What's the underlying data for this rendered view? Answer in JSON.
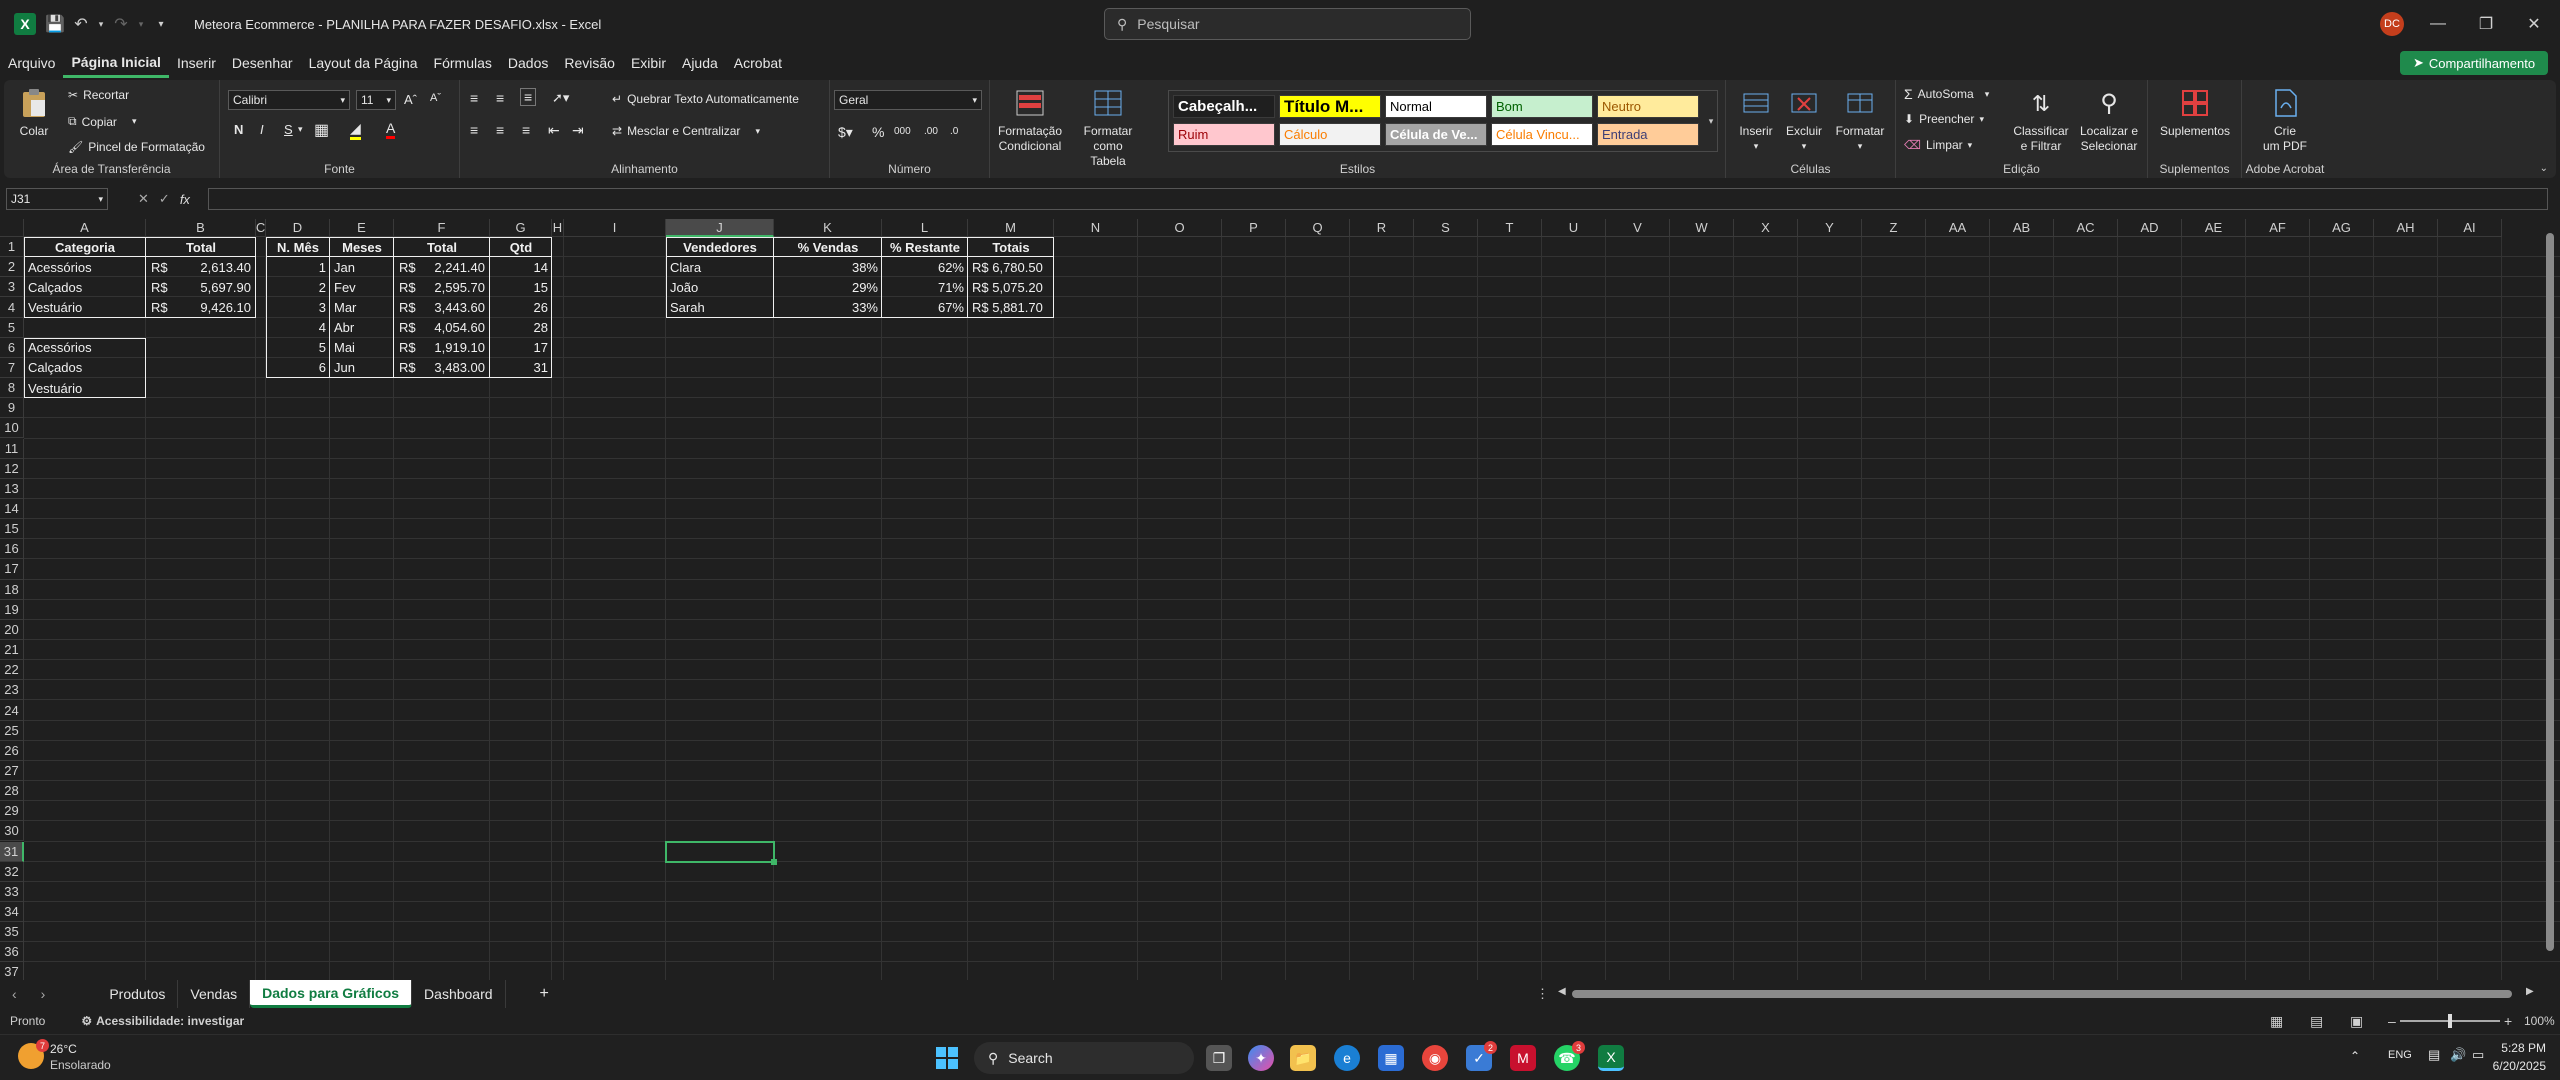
{
  "titlebar": {
    "doc_title": "Meteora Ecommerce - PLANILHA PARA FAZER DESAFIO.xlsx  -  Excel",
    "search_placeholder": "Pesquisar",
    "user_initials": "DC"
  },
  "menu": {
    "items": [
      "Arquivo",
      "Página Inicial",
      "Inserir",
      "Desenhar",
      "Layout da Página",
      "Fórmulas",
      "Dados",
      "Revisão",
      "Exibir",
      "Ajuda",
      "Acrobat"
    ],
    "share_label": "Compartilhamento"
  },
  "ribbon": {
    "clipboard": {
      "paste": "Colar",
      "cut": "Recortar",
      "copy": "Copiar",
      "format_painter": "Pincel de Formatação",
      "label": "Área de Transferência"
    },
    "font": {
      "family": "Calibri",
      "size": "11",
      "label": "Fonte"
    },
    "alignment": {
      "wrap": "Quebrar Texto Automaticamente",
      "merge": "Mesclar e Centralizar",
      "label": "Alinhamento"
    },
    "number": {
      "format": "Geral",
      "label": "Número"
    },
    "styles": {
      "cond_format": [
        "Formatação",
        "Condicional"
      ],
      "format_table": [
        "Formatar como",
        "Tabela"
      ],
      "cells": [
        "Cabeçalh...",
        "Título M...",
        "Normal",
        "Bom",
        "Neutro",
        "Ruim",
        "Cálculo",
        "Célula de Ve...",
        "Célula Vincu...",
        "Entrada"
      ],
      "label": "Estilos"
    },
    "cells": {
      "insert": "Inserir",
      "delete": "Excluir",
      "format": "Formatar",
      "label": "Células"
    },
    "editing": {
      "autosum": "AutoSoma",
      "fill": "Preencher",
      "clear": "Limpar",
      "sort": [
        "Classificar",
        "e Filtrar"
      ],
      "find": [
        "Localizar e",
        "Selecionar"
      ],
      "label": "Edição"
    },
    "addins": {
      "button": "Suplementos",
      "label": "Suplementos"
    },
    "acrobat": {
      "button": [
        "Crie",
        "um PDF"
      ],
      "label": "Adobe Acrobat"
    }
  },
  "formula_bar": {
    "namebox": "J31",
    "fx": "fx",
    "value": ""
  },
  "grid": {
    "columns": [
      "A",
      "B",
      "C",
      "D",
      "E",
      "F",
      "G",
      "H",
      "I",
      "J",
      "K",
      "L",
      "M",
      "N",
      "O",
      "P",
      "Q",
      "R",
      "S",
      "T",
      "U",
      "V",
      "W",
      "X",
      "Y",
      "Z",
      "AA",
      "AB",
      "AC",
      "AD",
      "AE",
      "AF",
      "AG",
      "AH",
      "AI"
    ],
    "rows": [
      "1",
      "2",
      "3",
      "4",
      "5",
      "6",
      "7",
      "8",
      "9",
      "10",
      "11",
      "12",
      "13",
      "14",
      "15",
      "16",
      "17",
      "18",
      "19",
      "20",
      "21",
      "22",
      "23",
      "24",
      "25",
      "26",
      "27",
      "28",
      "29",
      "30",
      "31",
      "32",
      "33",
      "34",
      "35",
      "36",
      "37"
    ],
    "table_categoria": {
      "headers": [
        "Categoria",
        "Total"
      ],
      "rows": [
        [
          "Acessórios",
          "R$",
          "2,613.40"
        ],
        [
          "Calçados",
          "R$",
          "5,697.90"
        ],
        [
          "Vestuário",
          "R$",
          "9,426.10"
        ]
      ]
    },
    "list_categoria": [
      "Acessórios",
      "Calçados",
      "Vestuário"
    ],
    "table_meses": {
      "headers": [
        "N. Mês",
        "Meses",
        "Total",
        "Qtd"
      ],
      "rows": [
        [
          "1",
          "Jan",
          "R$",
          "2,241.40",
          "14"
        ],
        [
          "2",
          "Fev",
          "R$",
          "2,595.70",
          "15"
        ],
        [
          "3",
          "Mar",
          "R$",
          "3,443.60",
          "26"
        ],
        [
          "4",
          "Abr",
          "R$",
          "4,054.60",
          "28"
        ],
        [
          "5",
          "Mai",
          "R$",
          "1,919.10",
          "17"
        ],
        [
          "6",
          "Jun",
          "R$",
          "3,483.00",
          "31"
        ]
      ]
    },
    "table_vendedores": {
      "headers": [
        "Vendedores",
        "% Vendas",
        "% Restante",
        "Totais"
      ],
      "rows": [
        [
          "Clara",
          "38%",
          "62%",
          "R$ 6,780.50"
        ],
        [
          "João",
          "29%",
          "71%",
          "R$ 5,075.20"
        ],
        [
          "Sarah",
          "33%",
          "67%",
          "R$ 5,881.70"
        ]
      ]
    }
  },
  "sheet_tabs": [
    "Produtos",
    "Vendas",
    "Dados para Gráficos",
    "Dashboard"
  ],
  "active_tab": "Dados para Gráficos",
  "statusbar": {
    "ready": "Pronto",
    "accessibility": "Acessibilidade: investigar",
    "zoom": "100%"
  },
  "taskbar": {
    "weather_temp": "26°C",
    "weather_desc": "Ensolarado",
    "search": "Search",
    "lang": "ENG",
    "time": "5:28 PM",
    "date": "6/20/2025",
    "badges": [
      "2",
      "3"
    ]
  },
  "colors": {
    "accent": "#107c41",
    "selection": "#3fb768",
    "titulo_bg": "#ffff00",
    "bom_bg": "#c6efce",
    "neutro_bg": "#ffeb9c",
    "ruim_bg": "#ffc7ce",
    "entrada_bg": "#ffcc99"
  }
}
